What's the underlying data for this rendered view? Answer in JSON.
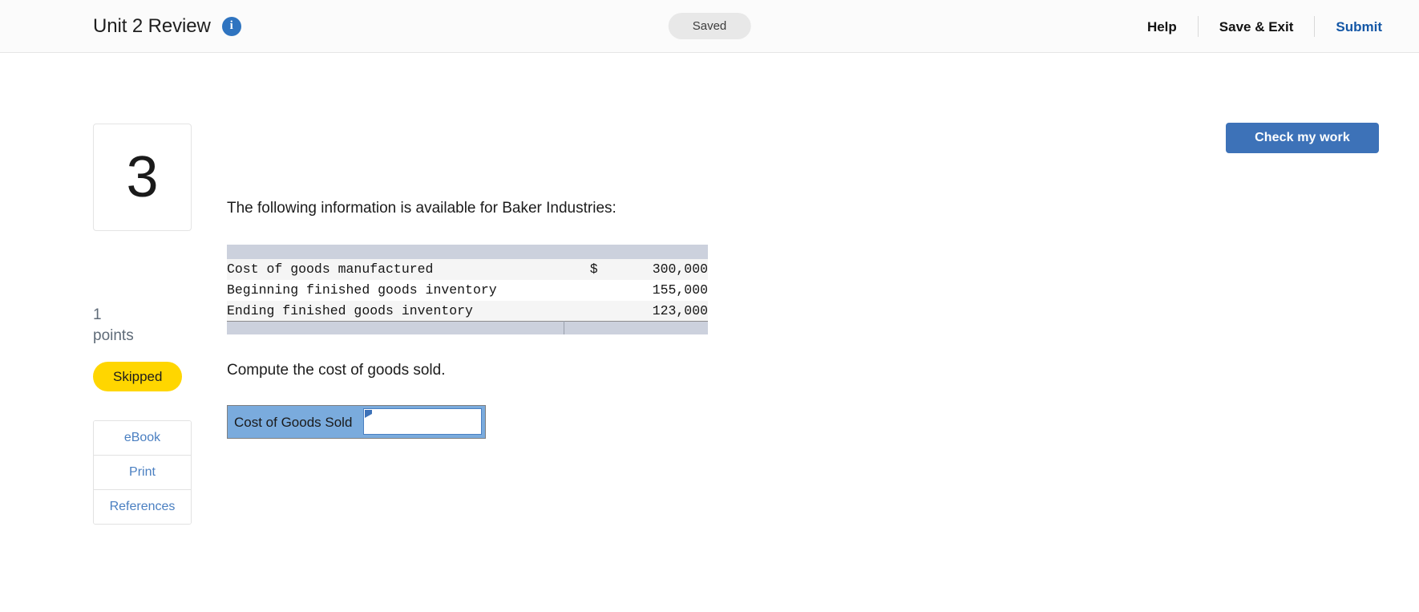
{
  "header": {
    "title": "Unit 2 Review",
    "info_icon": "info-icon",
    "info_icon_glyph": "i",
    "save_status": "Saved",
    "nav": {
      "help": "Help",
      "save_exit": "Save & Exit",
      "submit": "Submit"
    },
    "accent_color": "#1457a6"
  },
  "toolbar": {
    "check_work_label": "Check my work",
    "check_work_color": "#3d72b8"
  },
  "rail": {
    "question_number": "3",
    "points_value": "1",
    "points_label": "points",
    "status_badge": "Skipped",
    "status_badge_color": "#ffd600",
    "buttons": [
      {
        "label": "eBook"
      },
      {
        "label": "Print"
      },
      {
        "label": "References"
      }
    ]
  },
  "question": {
    "intro": "The following information is available for Baker Industries:",
    "prompt": "Compute the cost of goods sold.",
    "exhibit": {
      "rows": [
        {
          "label": "Cost of goods manufactured",
          "currency": "$",
          "amount": "300,000"
        },
        {
          "label": "Beginning finished goods inventory",
          "currency": "",
          "amount": "155,000"
        },
        {
          "label": "Ending finished goods inventory",
          "currency": "",
          "amount": "123,000"
        }
      ],
      "header_color": "#ccd1dd"
    },
    "answer": {
      "label": "Cost of Goods Sold",
      "value": "",
      "placeholder": "",
      "label_bg": "#7aabdd"
    }
  }
}
